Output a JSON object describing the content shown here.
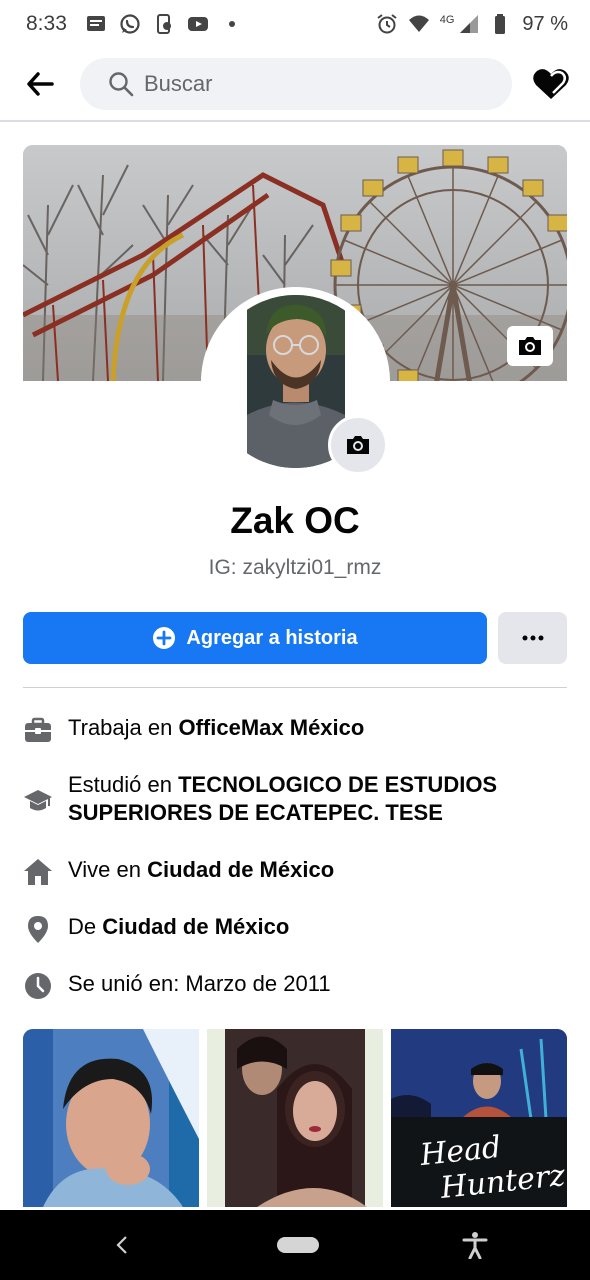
{
  "status_bar": {
    "time": "8:33",
    "network": "4G",
    "battery": "97 %"
  },
  "header": {
    "search_placeholder": "Buscar"
  },
  "profile": {
    "name": "Zak OC",
    "bio": "IG: zakyltzi01_rmz"
  },
  "actions": {
    "add_story_label": "Agregar a historia",
    "more_label": "···"
  },
  "intro": [
    {
      "icon": "briefcase-icon",
      "prefix": "Trabaja en ",
      "value": "OfficeMax México"
    },
    {
      "icon": "graduation-cap-icon",
      "prefix": "Estudió en ",
      "value": "TECNOLOGICO DE ESTUDIOS SUPERIORES DE ECATEPEC. TESE"
    },
    {
      "icon": "home-icon",
      "prefix": "Vive en ",
      "value": "Ciudad de México"
    },
    {
      "icon": "location-pin-icon",
      "prefix": "De ",
      "value": "Ciudad de México"
    },
    {
      "icon": "clock-icon",
      "prefix": "Se unió en: Marzo de 2011",
      "value": ""
    }
  ],
  "photos": {
    "third_photo_caption": "Head Hunterz"
  },
  "colors": {
    "accent": "#1877f2",
    "secondary_button": "#e4e6eb",
    "icon_gray": "#65676b",
    "search_bg": "#f0f2f5"
  }
}
